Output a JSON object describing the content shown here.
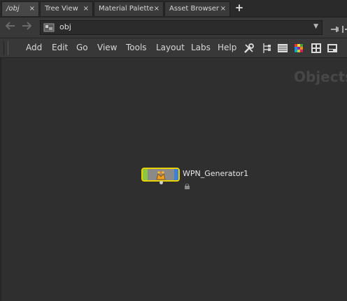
{
  "tabs": [
    {
      "label": "/obj",
      "close": "×",
      "active": true
    },
    {
      "label": "Tree View",
      "close": "×",
      "active": false
    },
    {
      "label": "Material Palette",
      "close": "×",
      "active": false
    },
    {
      "label": "Asset Browser",
      "close": "×",
      "active": false
    }
  ],
  "tab_add": "+",
  "path": {
    "value": "obj",
    "dropdown": "▼",
    "back_icon": "arrow-left-icon",
    "forward_icon": "arrow-right-icon"
  },
  "menu": {
    "items": [
      "Add",
      "Edit",
      "Go",
      "View",
      "Tools",
      "Layout",
      "Labs",
      "Help"
    ],
    "tool_icons": [
      "wrench-icon",
      "tree-layout-icon",
      "list-icon",
      "color-palette-icon",
      "shapes-icon",
      "display-icon"
    ]
  },
  "network": {
    "context_label": "Objects",
    "node": {
      "name": "WPN_Generator1",
      "colors": {
        "border": "#e8d200",
        "left_flag": "#8cc63f",
        "right_flag": "#3e7fd9",
        "body": "#8a8a8a"
      }
    }
  }
}
